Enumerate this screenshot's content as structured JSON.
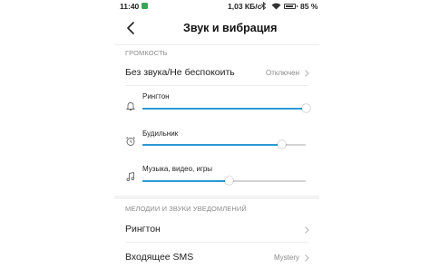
{
  "status_bar": {
    "time": "11:40",
    "network_speed": "1,03 КБ/с",
    "battery_percent": "85 %",
    "battery_level": 0.85
  },
  "header": {
    "title": "Звук и вибрация"
  },
  "sections": {
    "volume_header": "ГРОМКОСТЬ",
    "notifications_header": "МЕЛОДИИ И ЗВУКИ УВЕДОМЛЕНИЙ"
  },
  "dnd_row": {
    "label": "Без звука/Не беспокоить",
    "value": "Отключен"
  },
  "volumes": [
    {
      "label": "Рингтон",
      "level": 1.0,
      "icon": "bell-icon"
    },
    {
      "label": "Будильник",
      "level": 0.85,
      "icon": "alarm-clock-icon"
    },
    {
      "label": "Музыка, видео, игры",
      "level": 0.53,
      "icon": "music-note-icon"
    }
  ],
  "ringtone_row": {
    "label": "Рингтон"
  },
  "sms_row": {
    "label": "Входящее SMS",
    "value": "Mystery"
  },
  "colors": {
    "accent": "#2a9bd6",
    "divider": "#ededed",
    "secondary_text": "#8a8a8a"
  }
}
